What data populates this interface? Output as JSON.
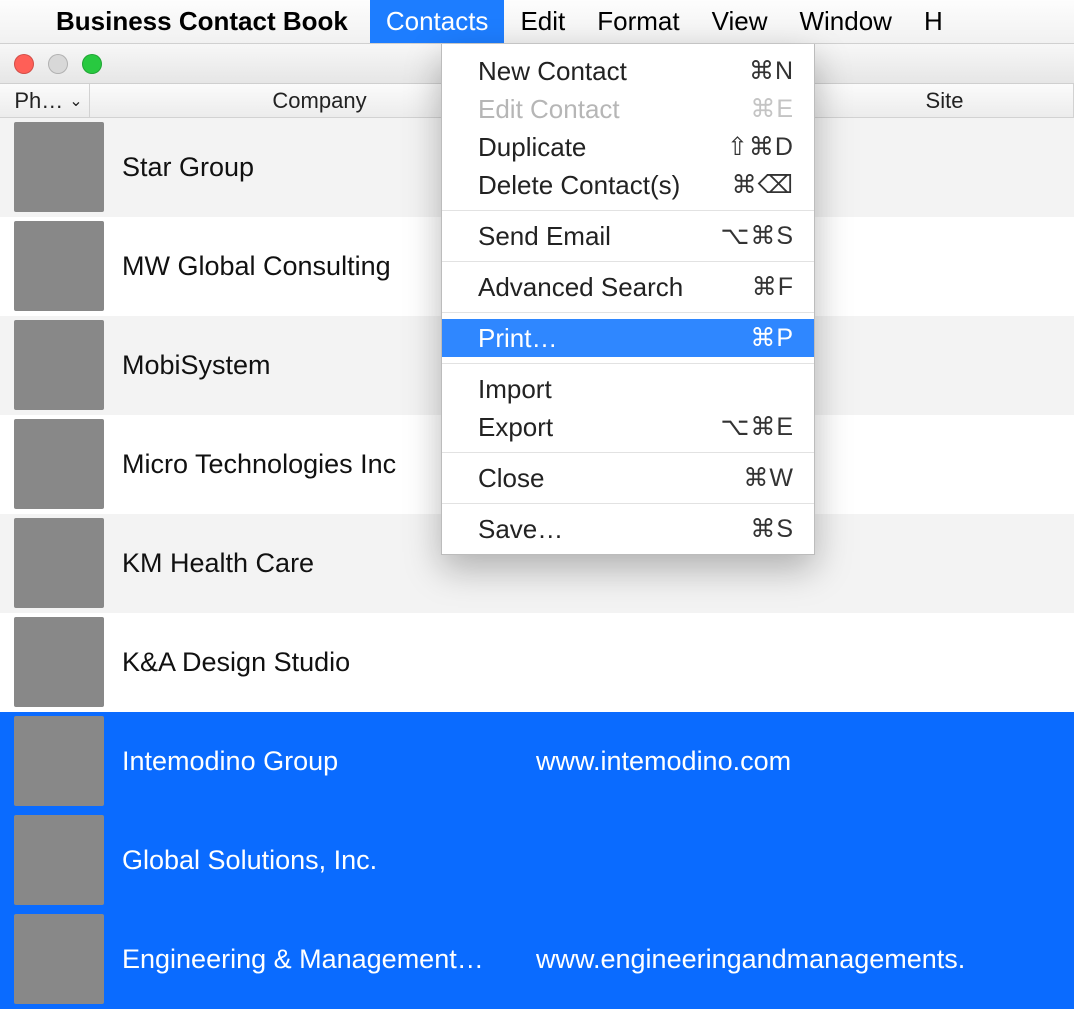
{
  "menubar": {
    "app_name": "Business Contact Book",
    "items": [
      "Contacts",
      "Edit",
      "Format",
      "View",
      "Window",
      "H"
    ],
    "active_index": 0
  },
  "columns": {
    "photo": "Ph…",
    "company": "Company",
    "site": "Site"
  },
  "rows": [
    {
      "company": "Star Group",
      "site": "",
      "selected": false,
      "alt": true,
      "thumb": "thumb-sunset"
    },
    {
      "company": "MW Global Consulting",
      "site": "",
      "selected": false,
      "alt": false,
      "thumb": "thumb-towers"
    },
    {
      "company": "MobiSystem",
      "site": "",
      "selected": false,
      "alt": true,
      "thumb": "thumb-glass"
    },
    {
      "company": "Micro Technologies Inc",
      "site": "",
      "selected": false,
      "alt": false,
      "thumb": "thumb-station"
    },
    {
      "company": "KM Health Care",
      "site": "",
      "selected": false,
      "alt": true,
      "thumb": "thumb-berries"
    },
    {
      "company": "K&A Design Studio",
      "site": "",
      "selected": false,
      "alt": false,
      "thumb": "thumb-currants"
    },
    {
      "company": "Intemodino Group",
      "site": "www.intemodino.com",
      "selected": true,
      "alt": false,
      "thumb": "thumb-hotel"
    },
    {
      "company": "Global Solutions, Inc.",
      "site": "",
      "selected": true,
      "alt": false,
      "thumb": "thumb-sky1"
    },
    {
      "company": "Engineering & Management…",
      "site": "www.engineeringandmanagements.",
      "selected": true,
      "alt": false,
      "thumb": "thumb-skyline"
    }
  ],
  "menu": {
    "groups": [
      [
        {
          "label": "New Contact",
          "shortcut": "⌘N",
          "disabled": false,
          "highlight": false
        },
        {
          "label": "Edit Contact",
          "shortcut": "⌘E",
          "disabled": true,
          "highlight": false
        },
        {
          "label": "Duplicate",
          "shortcut": "⇧⌘D",
          "disabled": false,
          "highlight": false
        },
        {
          "label": "Delete Contact(s)",
          "shortcut": "⌘⌫",
          "disabled": false,
          "highlight": false
        }
      ],
      [
        {
          "label": "Send Email",
          "shortcut": "⌥⌘S",
          "disabled": false,
          "highlight": false
        }
      ],
      [
        {
          "label": "Advanced Search",
          "shortcut": "⌘F",
          "disabled": false,
          "highlight": false
        }
      ],
      [
        {
          "label": "Print…",
          "shortcut": "⌘P",
          "disabled": false,
          "highlight": true
        }
      ],
      [
        {
          "label": "Import",
          "shortcut": "",
          "disabled": false,
          "highlight": false
        },
        {
          "label": "Export",
          "shortcut": "⌥⌘E",
          "disabled": false,
          "highlight": false
        }
      ],
      [
        {
          "label": "Close",
          "shortcut": "⌘W",
          "disabled": false,
          "highlight": false
        }
      ],
      [
        {
          "label": "Save…",
          "shortcut": "⌘S",
          "disabled": false,
          "highlight": false
        }
      ]
    ]
  }
}
